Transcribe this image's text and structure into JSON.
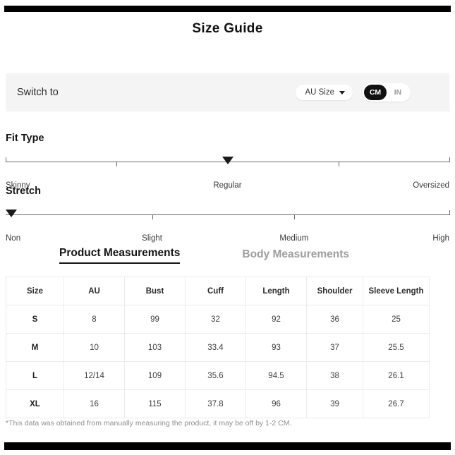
{
  "header": {
    "title": "Size Guide"
  },
  "switch_bar": {
    "label": "Switch to",
    "size_system": {
      "value": "AU Size",
      "chevron_icon": "chevron-down-icon"
    },
    "units": {
      "cm_label": "CM",
      "in_label": "IN",
      "selected": "CM"
    }
  },
  "fit_type": {
    "heading": "Fit Type",
    "labels": [
      "Skinny",
      "Regular",
      "Oversized"
    ],
    "label_positions_pct": [
      0,
      50,
      100
    ],
    "tick_positions_pct": [
      0,
      25,
      75,
      100
    ],
    "marker_label": "Regular",
    "marker_position_pct": 50
  },
  "stretch": {
    "heading": "Stretch",
    "labels": [
      "Non",
      "Slight",
      "Medium",
      "High"
    ],
    "label_positions_pct": [
      0,
      33,
      65,
      100
    ],
    "tick_positions_pct": [
      33,
      65,
      100
    ],
    "marker_label": "Non",
    "marker_position_pct": 0
  },
  "tabs": [
    {
      "label": "Product Measurements",
      "active": true
    },
    {
      "label": "Body Measurements",
      "active": false
    }
  ],
  "table": {
    "columns": [
      "Size",
      "AU",
      "Bust",
      "Cuff",
      "Length",
      "Shoulder",
      "Sleeve Length"
    ],
    "rows": [
      [
        "S",
        "8",
        "99",
        "32",
        "92",
        "36",
        "25"
      ],
      [
        "M",
        "10",
        "103",
        "33.4",
        "93",
        "37",
        "25.5"
      ],
      [
        "L",
        "12/14",
        "109",
        "35.6",
        "94.5",
        "38",
        "26.1"
      ],
      [
        "XL",
        "16",
        "115",
        "37.8",
        "96",
        "39",
        "26.7"
      ]
    ]
  },
  "footnote": "*This data was obtained from manually measuring the product, it may be off by 1-2 CM.",
  "colors": {
    "rail": "#000000",
    "band_bg": "#f4f4f4",
    "active_tab": "#141414",
    "inactive_tab": "#9d9d9d",
    "grid": "#ebebeb"
  }
}
